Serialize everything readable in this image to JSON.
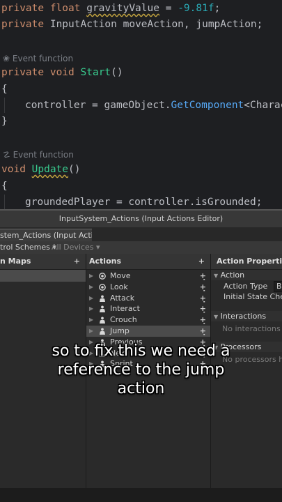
{
  "code": {
    "line1": {
      "kw": "private float ",
      "var": "gravityValue",
      "rest": " = ",
      "num": "-9.81f",
      "end": ";"
    },
    "line2": {
      "kw": "private ",
      "type": "InputAction",
      "rest": " moveAction, jumpAction;"
    },
    "hint1": "Event function",
    "line3": {
      "kw": "private void ",
      "fn": "Start",
      "rest": "()"
    },
    "brace_open": "{",
    "line4": {
      "a": "controller = gameObject.",
      "fn": "GetComponent",
      "b": "<Charact"
    },
    "brace_close": "}",
    "hint2": "Event function",
    "line5": {
      "kw": "void ",
      "fn": "Update",
      "rest": "()"
    },
    "brace_open2": "{",
    "line6": "groundedPlayer = controller.isGrounded;"
  },
  "editor": {
    "title": "InputSystem_Actions (Input Actions Editor)",
    "tab": "stem_Actions (Input Acti..",
    "control_schemes": "trol Schemes ▾",
    "all_devices": "All Devices ▾",
    "maps_header": "n Maps",
    "actions_header": "Actions",
    "props_header": "Action Properties",
    "actions": [
      {
        "label": "Move",
        "icon": "target-icon"
      },
      {
        "label": "Look",
        "icon": "target-icon"
      },
      {
        "label": "Attack",
        "icon": "person-icon"
      },
      {
        "label": "Interact",
        "icon": "person-icon"
      },
      {
        "label": "Crouch",
        "icon": "person-icon"
      },
      {
        "label": "Jump",
        "icon": "person-icon"
      },
      {
        "label": "Previous",
        "icon": "person-icon"
      },
      {
        "label": "Next",
        "icon": "person-icon"
      },
      {
        "label": "Sprint",
        "icon": "person-icon"
      }
    ],
    "selected_action": "Jump",
    "action_section": "Action",
    "action_type_label": "Action Type",
    "action_type_value": "Bu",
    "initial_state_label": "Initial State Check",
    "interactions_header": "Interactions",
    "interactions_empty": "No interactions hav",
    "processors_header": "Processors",
    "processors_empty": "No processors have"
  },
  "caption": {
    "line1": "so to fix this we need a",
    "line2": "reference to the jump",
    "line3": "action"
  },
  "colors": {
    "keyword": "#cf8e6d",
    "function": "#56a8f5",
    "number": "#2aacb8",
    "panel": "#2a2a2a"
  }
}
